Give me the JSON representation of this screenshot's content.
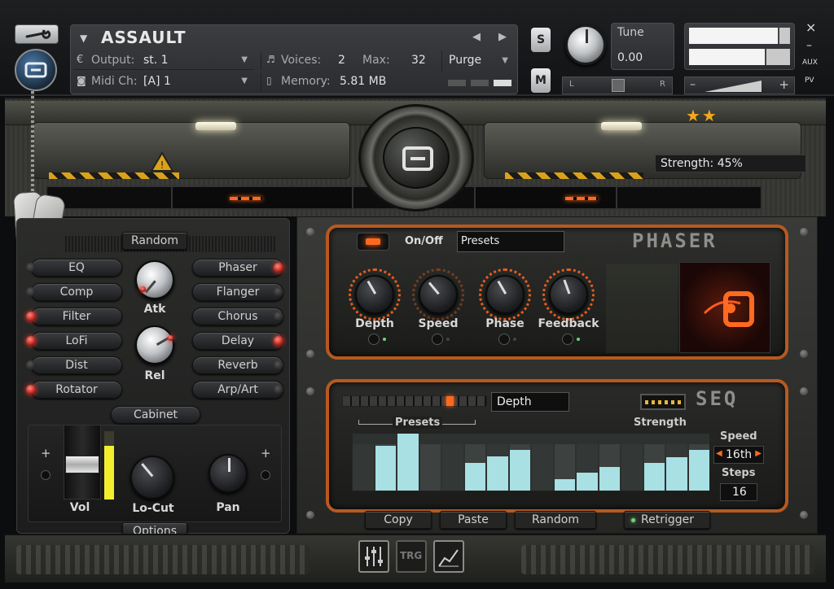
{
  "header": {
    "instrument_name": "ASSAULT",
    "output_label": "Output:",
    "output_value": "st. 1",
    "midi_label": "Midi Ch:",
    "midi_value": "[A] 1",
    "voices_label": "Voices:",
    "voices_value": "2",
    "max_label": "Max:",
    "max_value": "32",
    "memory_label": "Memory:",
    "memory_value": "5.81 MB",
    "purge_label": "Purge",
    "solo_label": "S",
    "mute_label": "M",
    "tune_label": "Tune",
    "tune_value": "0.00",
    "pan_left": "L",
    "pan_right": "R",
    "aux_label": "AUX",
    "pv_label": "PV",
    "close_label": "×",
    "minimize_label": "–",
    "vol_minus": "–",
    "vol_plus": "+",
    "level_top": 0.88,
    "level_bottom": 0.75
  },
  "top_banner": {
    "strength_text": "Strength: 45%",
    "stars": "★★"
  },
  "left_panel": {
    "random_label": "Random",
    "effects_left": [
      {
        "label": "EQ",
        "on": false
      },
      {
        "label": "Comp",
        "on": false
      },
      {
        "label": "Filter",
        "on": true
      },
      {
        "label": "LoFi",
        "on": true
      },
      {
        "label": "Dist",
        "on": false
      },
      {
        "label": "Rotator",
        "on": true
      }
    ],
    "effects_right": [
      {
        "label": "Phaser",
        "on": true
      },
      {
        "label": "Flanger",
        "on": false
      },
      {
        "label": "Chorus",
        "on": false
      },
      {
        "label": "Delay",
        "on": true
      },
      {
        "label": "Reverb",
        "on": false
      },
      {
        "label": "Arp/Art",
        "on": false
      }
    ],
    "atk_label": "Atk",
    "rel_label": "Rel",
    "cabinet_label": "Cabinet",
    "vol_label": "Vol",
    "locut_label": "Lo-Cut",
    "pan_label": "Pan",
    "options_label": "Options",
    "plus_label": "+"
  },
  "phaser": {
    "title": "PHASER",
    "onoff_label": "On/Off",
    "presets_label": "Presets",
    "knobs": [
      {
        "label": "Depth"
      },
      {
        "label": "Speed"
      },
      {
        "label": "Phase"
      },
      {
        "label": "Feedback"
      }
    ]
  },
  "seq": {
    "title": "SEQ",
    "target_value": "Depth",
    "presets_label": "Presets",
    "strength_label": "Strength",
    "speed_label": "Speed",
    "speed_value": "16th",
    "steps_label": "Steps",
    "steps_value": "16",
    "step_values": [
      0.0,
      0.78,
      1.0,
      0.0,
      0.0,
      0.48,
      0.6,
      0.72,
      0.0,
      0.2,
      0.32,
      0.42,
      0.0,
      0.48,
      0.58,
      0.72
    ],
    "copy_label": "Copy",
    "paste_label": "Paste",
    "random_label": "Random",
    "retrigger_label": "Retrigger"
  },
  "footer": {
    "trg_label": "TRG"
  },
  "colors": {
    "accent_orange": "#ff6a1f",
    "seq_bar": "#a8e0e4",
    "led_red": "#ff3b2f"
  }
}
